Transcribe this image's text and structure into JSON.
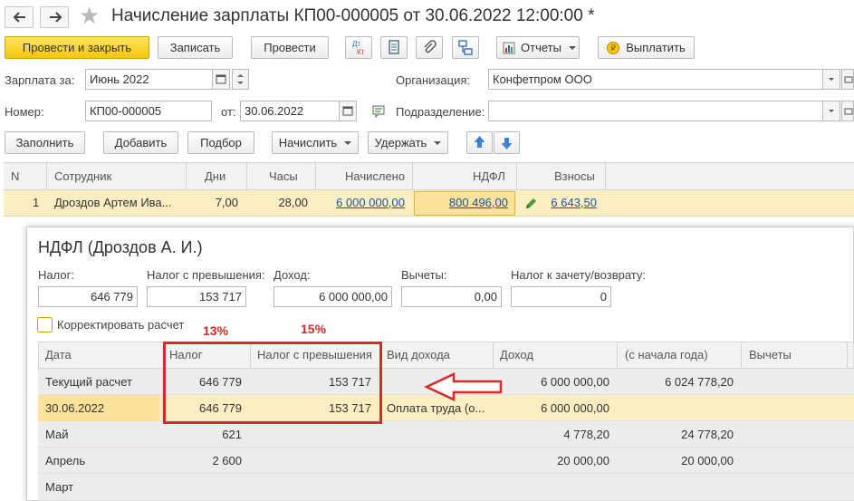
{
  "window": {
    "title": "Начисление зарплаты КП00-000005 от 30.06.2022 12:00:00 *"
  },
  "toolbar": {
    "post_close": "Провести и закрыть",
    "save": "Записать",
    "post": "Провести",
    "dt_kt_top": "Дт",
    "dt_kt_bottom": "Кт",
    "reports": "Отчеты",
    "pay": "Выплатить"
  },
  "form": {
    "salary_for_label": "Зарплата за:",
    "salary_for_value": "Июнь 2022",
    "organization_label": "Организация:",
    "organization_value": "Конфетпром ООО",
    "number_label": "Номер:",
    "number_value": "КП00-000005",
    "date_from_label": "от:",
    "date_value": "30.06.2022",
    "department_label": "Подразделение:",
    "department_value": ""
  },
  "actions": {
    "fill": "Заполнить",
    "add": "Добавить",
    "select": "Подбор",
    "accrue": "Начислить",
    "withhold": "Удержать"
  },
  "grid": {
    "headers": [
      "N",
      "Сотрудник",
      "Дни",
      "Часы",
      "Начислено",
      "НДФЛ",
      "Взносы"
    ],
    "row": {
      "n": "1",
      "employee": "Дроздов Артем Ива...",
      "days": "7,00",
      "hours": "28,00",
      "accrued": "6 000 000,00",
      "ndfl": "800 496,00",
      "contributions": "6 643,50"
    }
  },
  "popup": {
    "title": "НДФЛ (Дроздов А. И.)",
    "tax_label": "Налог:",
    "tax_value": "646 779",
    "excess_label": "Налог с превышения:",
    "excess_value": "153 717",
    "income_label": "Доход:",
    "income_value": "6 000 000,00",
    "deductions_label": "Вычеты:",
    "deductions_value": "0,00",
    "offset_label": "Налог к зачету/возврату:",
    "offset_value": "0",
    "adjust_checkbox": "Корректировать расчет",
    "annotation_13": "13%",
    "annotation_15": "15%",
    "table": {
      "headers": [
        "Дата",
        "Налог",
        "Налог с превышения",
        "Вид дохода",
        "Доход",
        "(с начала года)",
        "Вычеты"
      ],
      "rows": [
        {
          "date": "Текущий расчет",
          "tax": "646 779",
          "excess": "153 717",
          "income_type": "",
          "income": "6 000 000,00",
          "ytd": "6 024 778,20"
        },
        {
          "date": "30.06.2022",
          "tax": "646 779",
          "excess": "153 717",
          "income_type": "Оплата труда (о...",
          "income": "6 000 000,00",
          "ytd": ""
        },
        {
          "date": "Май",
          "tax": "621",
          "excess": "",
          "income_type": "",
          "income": "4 778,20",
          "ytd": "24 778,20"
        },
        {
          "date": "Апрель",
          "tax": "2 600",
          "excess": "",
          "income_type": "",
          "income": "20 000,00",
          "ytd": "20 000,00"
        },
        {
          "date": "Март",
          "tax": "",
          "excess": "",
          "income_type": "",
          "income": "",
          "ytd": ""
        }
      ]
    }
  },
  "colors": {
    "accent_yellow": "#f5c50f",
    "selected_row": "#fbeec2",
    "annotation_red": "#d42a2a",
    "link_blue": "#1a55a8"
  }
}
